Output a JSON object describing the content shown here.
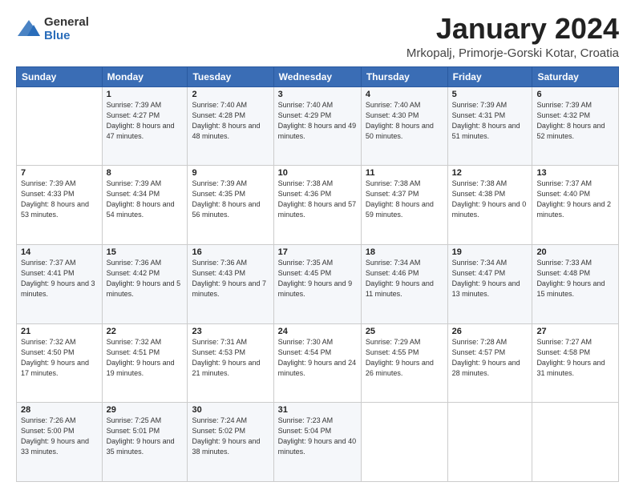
{
  "logo": {
    "general": "General",
    "blue": "Blue"
  },
  "header": {
    "month": "January 2024",
    "location": "Mrkopalj, Primorje-Gorski Kotar, Croatia"
  },
  "weekdays": [
    "Sunday",
    "Monday",
    "Tuesday",
    "Wednesday",
    "Thursday",
    "Friday",
    "Saturday"
  ],
  "weeks": [
    [
      {
        "num": "",
        "sunrise": "",
        "sunset": "",
        "daylight": ""
      },
      {
        "num": "1",
        "sunrise": "Sunrise: 7:39 AM",
        "sunset": "Sunset: 4:27 PM",
        "daylight": "Daylight: 8 hours and 47 minutes."
      },
      {
        "num": "2",
        "sunrise": "Sunrise: 7:40 AM",
        "sunset": "Sunset: 4:28 PM",
        "daylight": "Daylight: 8 hours and 48 minutes."
      },
      {
        "num": "3",
        "sunrise": "Sunrise: 7:40 AM",
        "sunset": "Sunset: 4:29 PM",
        "daylight": "Daylight: 8 hours and 49 minutes."
      },
      {
        "num": "4",
        "sunrise": "Sunrise: 7:40 AM",
        "sunset": "Sunset: 4:30 PM",
        "daylight": "Daylight: 8 hours and 50 minutes."
      },
      {
        "num": "5",
        "sunrise": "Sunrise: 7:39 AM",
        "sunset": "Sunset: 4:31 PM",
        "daylight": "Daylight: 8 hours and 51 minutes."
      },
      {
        "num": "6",
        "sunrise": "Sunrise: 7:39 AM",
        "sunset": "Sunset: 4:32 PM",
        "daylight": "Daylight: 8 hours and 52 minutes."
      }
    ],
    [
      {
        "num": "7",
        "sunrise": "Sunrise: 7:39 AM",
        "sunset": "Sunset: 4:33 PM",
        "daylight": "Daylight: 8 hours and 53 minutes."
      },
      {
        "num": "8",
        "sunrise": "Sunrise: 7:39 AM",
        "sunset": "Sunset: 4:34 PM",
        "daylight": "Daylight: 8 hours and 54 minutes."
      },
      {
        "num": "9",
        "sunrise": "Sunrise: 7:39 AM",
        "sunset": "Sunset: 4:35 PM",
        "daylight": "Daylight: 8 hours and 56 minutes."
      },
      {
        "num": "10",
        "sunrise": "Sunrise: 7:38 AM",
        "sunset": "Sunset: 4:36 PM",
        "daylight": "Daylight: 8 hours and 57 minutes."
      },
      {
        "num": "11",
        "sunrise": "Sunrise: 7:38 AM",
        "sunset": "Sunset: 4:37 PM",
        "daylight": "Daylight: 8 hours and 59 minutes."
      },
      {
        "num": "12",
        "sunrise": "Sunrise: 7:38 AM",
        "sunset": "Sunset: 4:38 PM",
        "daylight": "Daylight: 9 hours and 0 minutes."
      },
      {
        "num": "13",
        "sunrise": "Sunrise: 7:37 AM",
        "sunset": "Sunset: 4:40 PM",
        "daylight": "Daylight: 9 hours and 2 minutes."
      }
    ],
    [
      {
        "num": "14",
        "sunrise": "Sunrise: 7:37 AM",
        "sunset": "Sunset: 4:41 PM",
        "daylight": "Daylight: 9 hours and 3 minutes."
      },
      {
        "num": "15",
        "sunrise": "Sunrise: 7:36 AM",
        "sunset": "Sunset: 4:42 PM",
        "daylight": "Daylight: 9 hours and 5 minutes."
      },
      {
        "num": "16",
        "sunrise": "Sunrise: 7:36 AM",
        "sunset": "Sunset: 4:43 PM",
        "daylight": "Daylight: 9 hours and 7 minutes."
      },
      {
        "num": "17",
        "sunrise": "Sunrise: 7:35 AM",
        "sunset": "Sunset: 4:45 PM",
        "daylight": "Daylight: 9 hours and 9 minutes."
      },
      {
        "num": "18",
        "sunrise": "Sunrise: 7:34 AM",
        "sunset": "Sunset: 4:46 PM",
        "daylight": "Daylight: 9 hours and 11 minutes."
      },
      {
        "num": "19",
        "sunrise": "Sunrise: 7:34 AM",
        "sunset": "Sunset: 4:47 PM",
        "daylight": "Daylight: 9 hours and 13 minutes."
      },
      {
        "num": "20",
        "sunrise": "Sunrise: 7:33 AM",
        "sunset": "Sunset: 4:48 PM",
        "daylight": "Daylight: 9 hours and 15 minutes."
      }
    ],
    [
      {
        "num": "21",
        "sunrise": "Sunrise: 7:32 AM",
        "sunset": "Sunset: 4:50 PM",
        "daylight": "Daylight: 9 hours and 17 minutes."
      },
      {
        "num": "22",
        "sunrise": "Sunrise: 7:32 AM",
        "sunset": "Sunset: 4:51 PM",
        "daylight": "Daylight: 9 hours and 19 minutes."
      },
      {
        "num": "23",
        "sunrise": "Sunrise: 7:31 AM",
        "sunset": "Sunset: 4:53 PM",
        "daylight": "Daylight: 9 hours and 21 minutes."
      },
      {
        "num": "24",
        "sunrise": "Sunrise: 7:30 AM",
        "sunset": "Sunset: 4:54 PM",
        "daylight": "Daylight: 9 hours and 24 minutes."
      },
      {
        "num": "25",
        "sunrise": "Sunrise: 7:29 AM",
        "sunset": "Sunset: 4:55 PM",
        "daylight": "Daylight: 9 hours and 26 minutes."
      },
      {
        "num": "26",
        "sunrise": "Sunrise: 7:28 AM",
        "sunset": "Sunset: 4:57 PM",
        "daylight": "Daylight: 9 hours and 28 minutes."
      },
      {
        "num": "27",
        "sunrise": "Sunrise: 7:27 AM",
        "sunset": "Sunset: 4:58 PM",
        "daylight": "Daylight: 9 hours and 31 minutes."
      }
    ],
    [
      {
        "num": "28",
        "sunrise": "Sunrise: 7:26 AM",
        "sunset": "Sunset: 5:00 PM",
        "daylight": "Daylight: 9 hours and 33 minutes."
      },
      {
        "num": "29",
        "sunrise": "Sunrise: 7:25 AM",
        "sunset": "Sunset: 5:01 PM",
        "daylight": "Daylight: 9 hours and 35 minutes."
      },
      {
        "num": "30",
        "sunrise": "Sunrise: 7:24 AM",
        "sunset": "Sunset: 5:02 PM",
        "daylight": "Daylight: 9 hours and 38 minutes."
      },
      {
        "num": "31",
        "sunrise": "Sunrise: 7:23 AM",
        "sunset": "Sunset: 5:04 PM",
        "daylight": "Daylight: 9 hours and 40 minutes."
      },
      {
        "num": "",
        "sunrise": "",
        "sunset": "",
        "daylight": ""
      },
      {
        "num": "",
        "sunrise": "",
        "sunset": "",
        "daylight": ""
      },
      {
        "num": "",
        "sunrise": "",
        "sunset": "",
        "daylight": ""
      }
    ]
  ]
}
